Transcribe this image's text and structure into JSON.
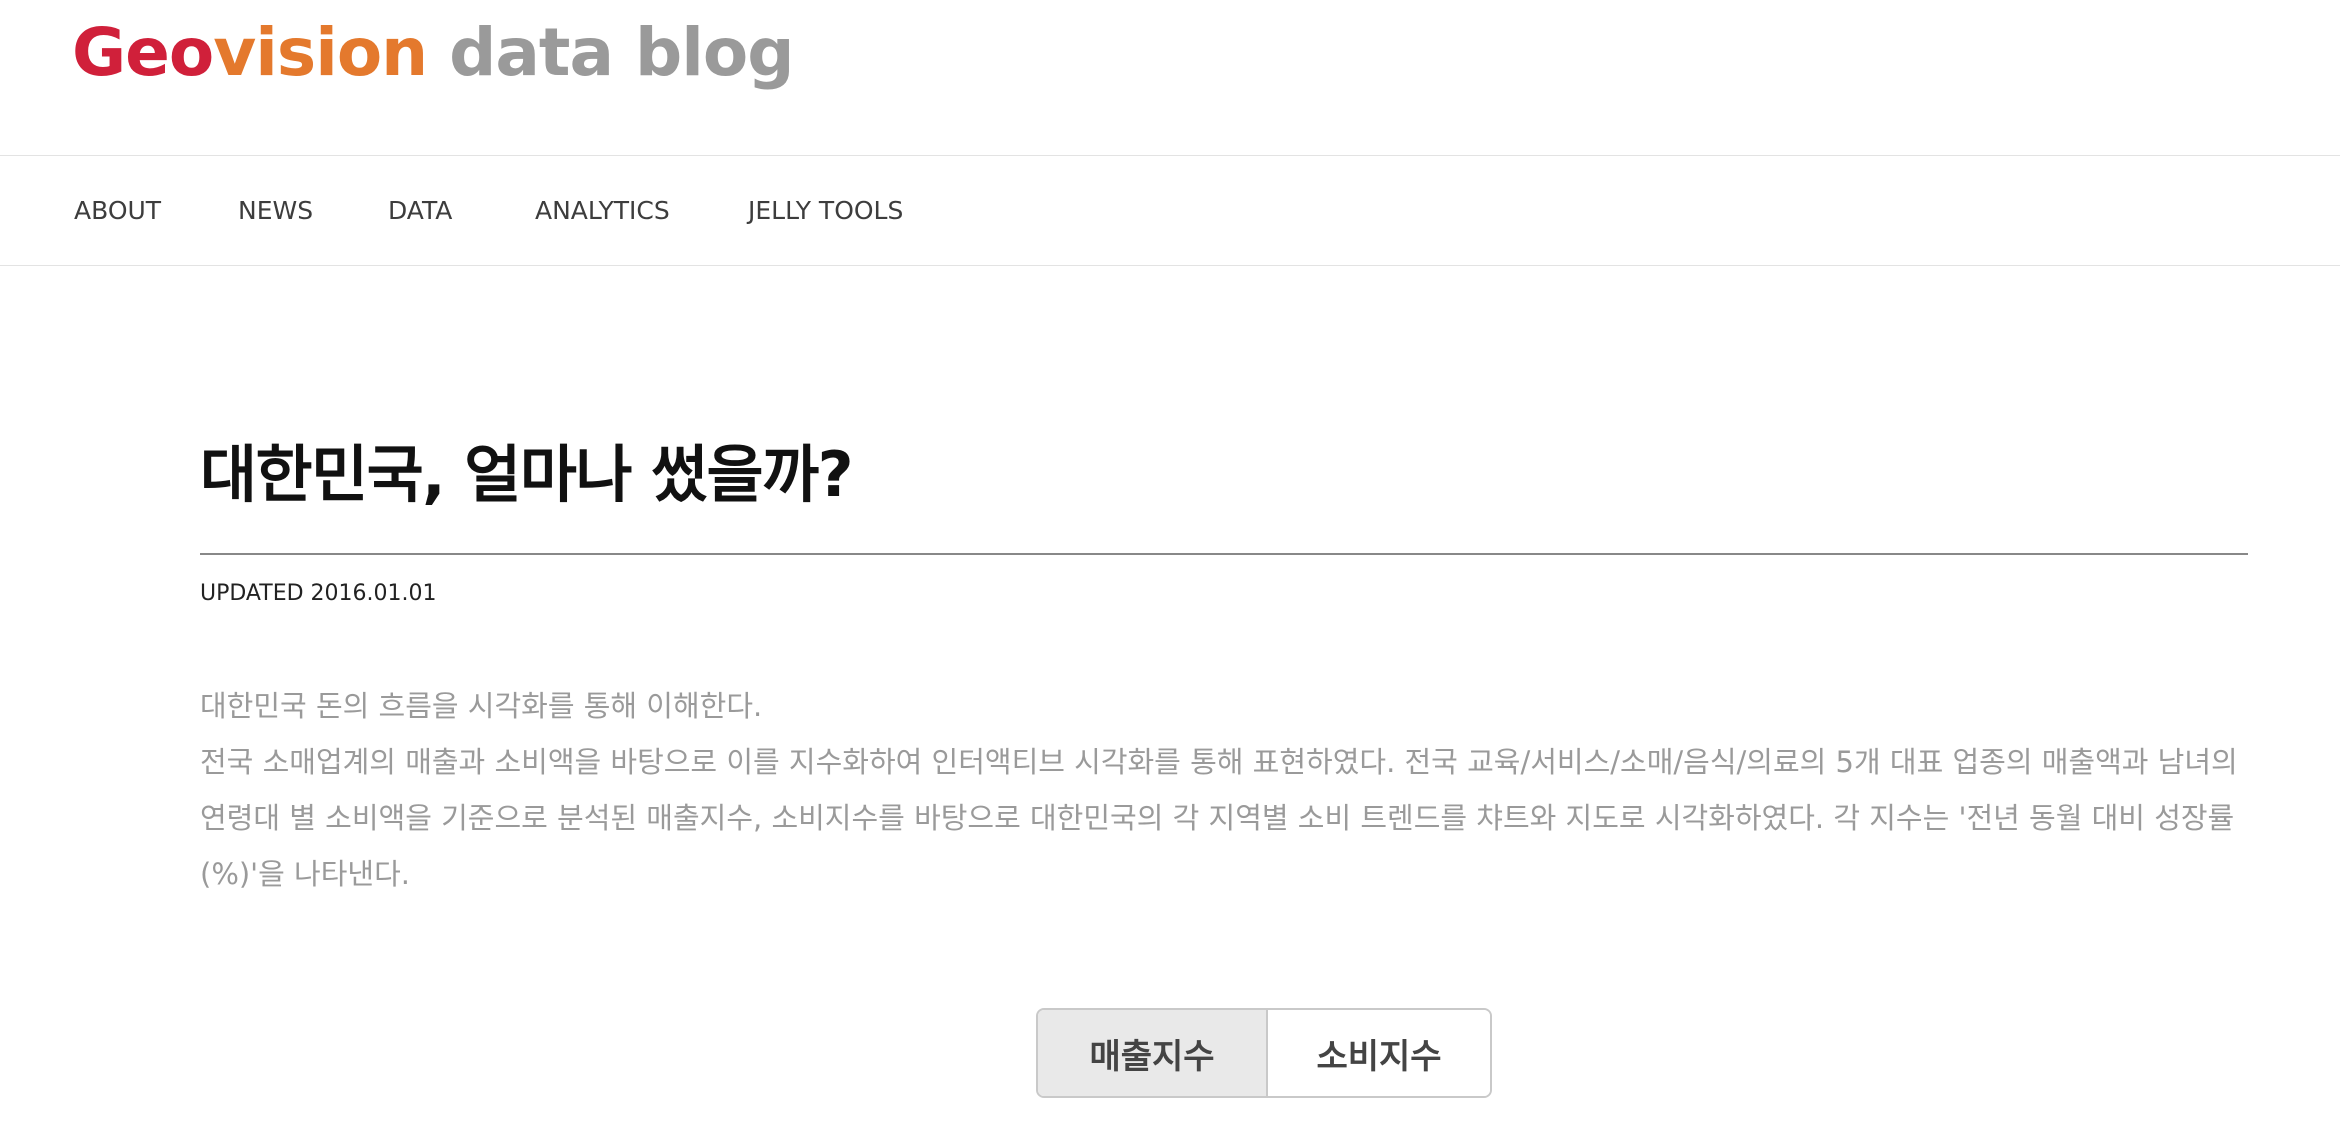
{
  "logo": {
    "part1": "Geo",
    "part2": "vision",
    "part3": " data blog",
    "colors": {
      "geo": "#d0203a",
      "vision": "#e4792d",
      "tail": "#9a9a9a"
    }
  },
  "nav": {
    "items": [
      {
        "label": "ABOUT"
      },
      {
        "label": "NEWS"
      },
      {
        "label": "DATA"
      },
      {
        "label": "ANALYTICS"
      },
      {
        "label": "JELLY TOOLS"
      }
    ]
  },
  "article": {
    "title": "대한민국, 얼마나 썼을까?",
    "updated": "UPDATED 2016.01.01",
    "paragraph1": "대한민국 돈의 흐름을 시각화를 통해 이해한다.",
    "paragraph2": "전국 소매업계의 매출과 소비액을 바탕으로 이를 지수화하여 인터액티브 시각화를 통해 표현하였다. 전국 교육/서비스/소매/음식/의료의 5개 대표 업종의 매출액과 남녀의 연령대 별 소비액을 기준으로 분석된 매출지수, 소비지수를 바탕으로 대한민국의 각 지역별 소비 트렌드를 챠트와 지도로 시각화하였다. 각 지수는 '전년 동월 대비 성장률(%)'을 나타낸다."
  },
  "toggle": {
    "sales_label": "매출지수",
    "consumption_label": "소비지수",
    "selected": "매출지수"
  }
}
